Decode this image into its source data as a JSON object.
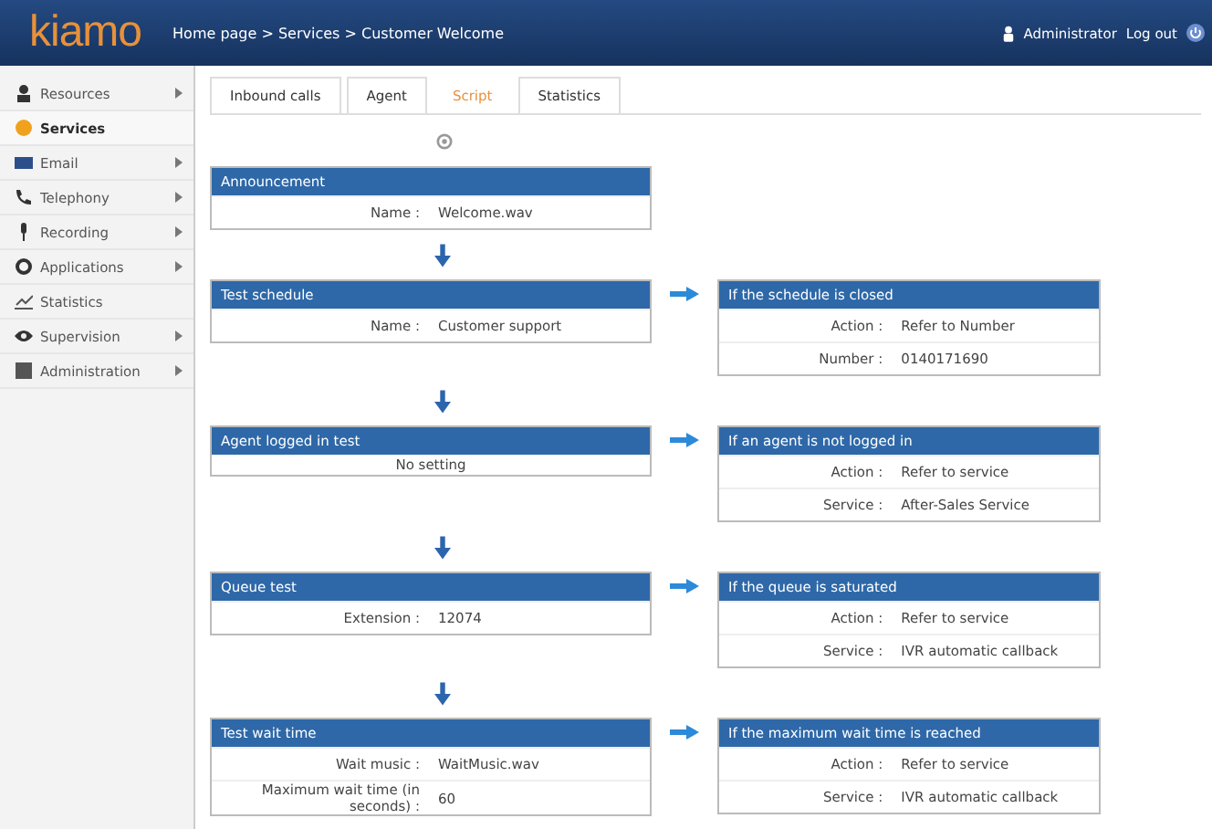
{
  "header": {
    "logo": "kiamo",
    "breadcrumb": "Home page > Services > Customer Welcome",
    "user": "Administrator",
    "logout": "Log out"
  },
  "sidebar": {
    "items": [
      {
        "label": "Resources",
        "submenu": true,
        "selected": false
      },
      {
        "label": "Services",
        "submenu": false,
        "selected": true
      },
      {
        "label": "Email",
        "submenu": true,
        "selected": false
      },
      {
        "label": "Telephony",
        "submenu": true,
        "selected": false
      },
      {
        "label": "Recording",
        "submenu": true,
        "selected": false
      },
      {
        "label": "Applications",
        "submenu": true,
        "selected": false
      },
      {
        "label": "Statistics",
        "submenu": false,
        "selected": false
      },
      {
        "label": "Supervision",
        "submenu": true,
        "selected": false
      },
      {
        "label": "Administration",
        "submenu": true,
        "selected": false
      }
    ]
  },
  "tabs": [
    {
      "label": "Inbound calls",
      "selected": false
    },
    {
      "label": "Agent",
      "selected": false
    },
    {
      "label": "Script",
      "selected": true
    },
    {
      "label": "Statistics",
      "selected": false
    }
  ],
  "steps": [
    {
      "title": "Announcement",
      "fields": [
        {
          "label": "Name :",
          "value": "Welcome.wav"
        }
      ]
    },
    {
      "title": "Test schedule",
      "fields": [
        {
          "label": "Name :",
          "value": "Customer support"
        }
      ],
      "branch": {
        "title": "If the schedule is closed",
        "fields": [
          {
            "label": "Action :",
            "value": "Refer to Number"
          },
          {
            "label": "Number :",
            "value": "0140171690"
          }
        ]
      }
    },
    {
      "title": "Agent logged in test",
      "note": "No setting",
      "branch": {
        "title": "If an agent is not logged in",
        "fields": [
          {
            "label": "Action :",
            "value": "Refer to service"
          },
          {
            "label": "Service :",
            "value": "After-Sales Service"
          }
        ]
      }
    },
    {
      "title": "Queue test",
      "fields": [
        {
          "label": "Extension :",
          "value": "12074"
        }
      ],
      "branch": {
        "title": "If the queue is saturated",
        "fields": [
          {
            "label": "Action :",
            "value": "Refer to service"
          },
          {
            "label": "Service :",
            "value": "IVR automatic callback"
          }
        ]
      }
    },
    {
      "title": "Test wait time",
      "fields": [
        {
          "label": "Wait music :",
          "value": "WaitMusic.wav"
        },
        {
          "label": "Maximum wait time (in seconds) :",
          "value": "60"
        }
      ],
      "branch": {
        "title": "If the maximum wait time is reached",
        "fields": [
          {
            "label": "Action :",
            "value": "Refer to service"
          },
          {
            "label": "Service :",
            "value": "IVR automatic callback"
          }
        ]
      }
    }
  ]
}
